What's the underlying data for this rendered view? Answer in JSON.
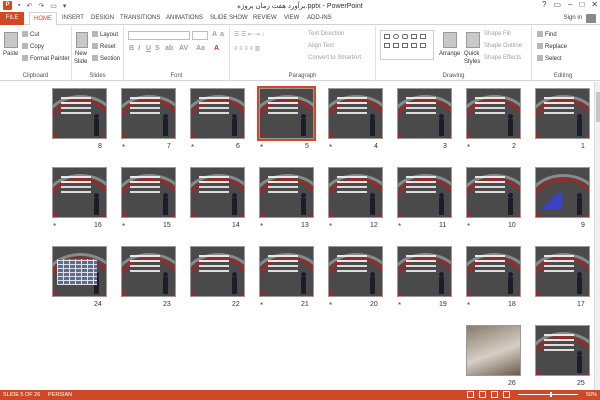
{
  "window": {
    "title": "برآورد هفت زمان پروژه.pptx - PowerPoint",
    "controls": [
      "?",
      "▭",
      "–",
      "□",
      "✕"
    ]
  },
  "tabs": [
    "FILE",
    "HOME",
    "INSERT",
    "DESIGN",
    "TRANSITIONS",
    "ANIMATIONS",
    "SLIDE SHOW",
    "REVIEW",
    "VIEW",
    "ADD-INS"
  ],
  "active_tab": "HOME",
  "account": {
    "signin": "Sign in"
  },
  "ribbon": {
    "clipboard": {
      "label": "Clipboard",
      "paste": "Paste",
      "cut": "Cut",
      "copy": "Copy",
      "format_painter": "Format Painter"
    },
    "slides": {
      "label": "Slides",
      "new_slide": "New",
      "new_slide2": "Slide",
      "layout": "Layout",
      "reset": "Reset",
      "section": "Section"
    },
    "font": {
      "label": "Font"
    },
    "paragraph": {
      "label": "Paragraph",
      "text_direction": "Text Direction",
      "align_text": "Align Text",
      "convert_smartart": "Convert to SmartArt"
    },
    "drawing": {
      "label": "Drawing",
      "arrange": "Arrange",
      "quick_styles": "Quick",
      "quick_styles2": "Styles",
      "shape_fill": "Shape Fill",
      "shape_outline": "Shape Outline",
      "shape_effects": "Shape Effects"
    },
    "editing": {
      "label": "Editing",
      "find": "Find",
      "replace": "Replace",
      "select": "Select"
    }
  },
  "slides": [
    {
      "num": "1",
      "star": false,
      "kind": "title"
    },
    {
      "num": "2",
      "star": true,
      "kind": "text"
    },
    {
      "num": "3",
      "star": false,
      "kind": "text"
    },
    {
      "num": "4",
      "star": true,
      "kind": "text"
    },
    {
      "num": "5",
      "star": true,
      "kind": "diagram",
      "selected": true
    },
    {
      "num": "6",
      "star": true,
      "kind": "text"
    },
    {
      "num": "7",
      "star": true,
      "kind": "text"
    },
    {
      "num": "8",
      "star": false,
      "kind": "text"
    },
    {
      "num": "9",
      "star": false,
      "kind": "chart"
    },
    {
      "num": "10",
      "star": true,
      "kind": "text"
    },
    {
      "num": "11",
      "star": true,
      "kind": "text"
    },
    {
      "num": "12",
      "star": true,
      "kind": "text"
    },
    {
      "num": "13",
      "star": true,
      "kind": "text"
    },
    {
      "num": "14",
      "star": false,
      "kind": "diagram"
    },
    {
      "num": "15",
      "star": true,
      "kind": "diagram"
    },
    {
      "num": "16",
      "star": true,
      "kind": "diagram"
    },
    {
      "num": "17",
      "star": false,
      "kind": "text"
    },
    {
      "num": "18",
      "star": true,
      "kind": "text"
    },
    {
      "num": "19",
      "star": true,
      "kind": "text"
    },
    {
      "num": "20",
      "star": true,
      "kind": "text"
    },
    {
      "num": "21",
      "star": true,
      "kind": "text"
    },
    {
      "num": "22",
      "star": false,
      "kind": "diagram"
    },
    {
      "num": "23",
      "star": false,
      "kind": "text"
    },
    {
      "num": "24",
      "star": false,
      "kind": "grid"
    },
    {
      "num": "25",
      "star": false,
      "kind": "text"
    },
    {
      "num": "26",
      "star": false,
      "kind": "photo"
    }
  ],
  "status": {
    "slide_info": "SLIDE 5 OF 26",
    "language": "PERSIAN",
    "zoom": "50%"
  },
  "colors": {
    "accent": "#d24726",
    "selected_outline": "#d24726"
  }
}
